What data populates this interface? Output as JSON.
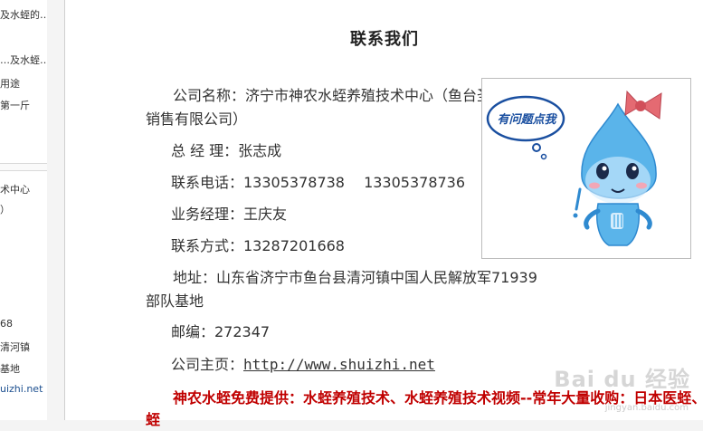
{
  "sidebar": {
    "top_items": [
      "及水蛭的…",
      "…及水蛭…",
      "用途",
      "第一斤"
    ],
    "bottom_items": [
      "术中心",
      "）",
      "68",
      "清河镇",
      "基地",
      "uizhi.net"
    ]
  },
  "page": {
    "title": "联系我们"
  },
  "contact": {
    "company": "公司名称：济宁市神农水蛭养殖技术中心（鱼台圣柏水蛭销售有限公司）",
    "manager": "总  经  理：张志成",
    "phone": "联系电话：13305378738　 13305378736",
    "business_manager": "业务经理：王庆友",
    "contact_method": "联系方式：13287201668",
    "address": "地址：山东省济宁市鱼台县清河镇中国人民解放军71939部队基地",
    "postcode": "邮编：272347",
    "homepage_label": "公司主页：",
    "homepage_url": "http://www.shuizhi.net"
  },
  "promo_text": "神农水蛭免费提供：水蛭养殖技术、水蛭养殖技术视频--常年大量收购：日本医蛭、菲牛蛭",
  "help_widget": {
    "bubble_text": "有问题点我",
    "colors": {
      "drop": "#5ab4ea",
      "bow": "#e46a72",
      "bubble_text": "#1a4fa0"
    }
  },
  "watermark": {
    "text": "Bai du 经验",
    "url": "jingyan.baidu.com"
  }
}
